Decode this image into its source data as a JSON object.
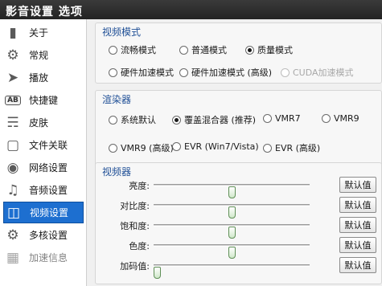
{
  "window": {
    "title": "影音设置  选项"
  },
  "sidebar": {
    "items": [
      {
        "label": "关于",
        "icon": "info-book-icon"
      },
      {
        "label": "常规",
        "icon": "gear-icon"
      },
      {
        "label": "播放",
        "icon": "play-arrow-icon"
      },
      {
        "label": "快捷键",
        "icon": "ab-key-icon",
        "icon_text": "AB"
      },
      {
        "label": "皮肤",
        "icon": "shirt-icon"
      },
      {
        "label": "文件关联",
        "icon": "folder-icon"
      },
      {
        "label": "网络设置",
        "icon": "globe-icon"
      },
      {
        "label": "音频设置",
        "icon": "audio-icon"
      },
      {
        "label": "视频设置",
        "icon": "tv-icon",
        "active": true
      },
      {
        "label": "多核设置",
        "icon": "multicore-gear-icon"
      },
      {
        "label": "加速信息",
        "icon": "acceleration-icon"
      }
    ]
  },
  "video_mode": {
    "title": "视频模式",
    "options": [
      {
        "label": "流畅模式",
        "checked": false,
        "disabled": false
      },
      {
        "label": "普通模式",
        "checked": false,
        "disabled": false
      },
      {
        "label": "质量模式",
        "checked": true,
        "disabled": false
      },
      {
        "label": "硬件加速模式",
        "checked": false,
        "disabled": false
      },
      {
        "label": "硬件加速模式 (高级)",
        "checked": false,
        "disabled": false
      },
      {
        "label": "CUDA加速模式",
        "checked": false,
        "disabled": true
      }
    ]
  },
  "renderer": {
    "title": "渲染器",
    "options": [
      {
        "label": "系统默认",
        "checked": false
      },
      {
        "label": "覆盖混合器 (推荐)",
        "checked": true
      },
      {
        "label": "VMR7",
        "checked": false
      },
      {
        "label": "VMR9",
        "checked": false
      },
      {
        "label": "VMR9 (高级)",
        "checked": false
      },
      {
        "label": "EVR (Win7/Vista)",
        "checked": false
      },
      {
        "label": "EVR (高级)",
        "checked": false
      }
    ]
  },
  "video_adjust": {
    "title": "视频器",
    "reset_label": "默认值",
    "sliders": [
      {
        "label": "亮度:",
        "value": 0.5
      },
      {
        "label": "对比度:",
        "value": 0.5
      },
      {
        "label": "饱和度:",
        "value": 0.5
      },
      {
        "label": "色度:",
        "value": 0.5
      },
      {
        "label": "加码值:",
        "value": 0.02
      }
    ]
  },
  "colors": {
    "accent": "#1d6fd0",
    "title_bar": "#2b2b2b",
    "group_title": "#1f4f96",
    "slider_thumb": "#cfe8c9"
  }
}
